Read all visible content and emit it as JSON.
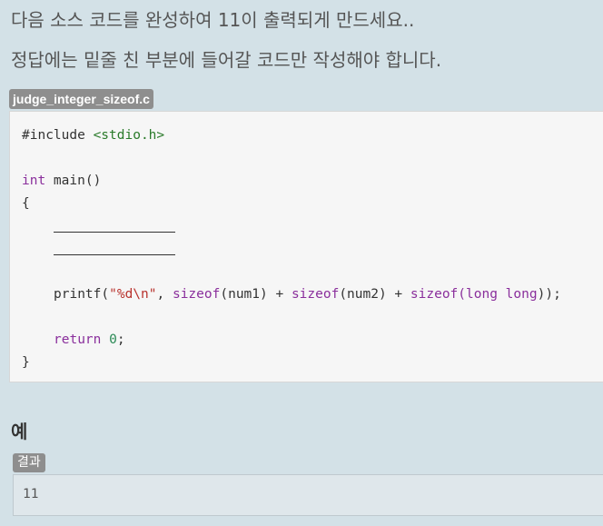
{
  "instructions": {
    "line1": "다음 소스 코드를 완성하여 11이 출력되게 만드세요..",
    "line2": "정답에는 밑줄 친 부분에 들어갈 코드만 작성해야 합니다."
  },
  "code_block": {
    "filename": "judge_integer_sizeof.c",
    "lines": {
      "include_directive": "#include",
      "include_header": "<stdio.h>",
      "int_keyword": "int",
      "main_sig": " main()",
      "open_brace": "{",
      "printf_name": "printf(",
      "format_string": "\"%d\\n\"",
      "comma_space": ", ",
      "sizeof_kw_1": "sizeof",
      "arg_num1": "(num1) + ",
      "sizeof_kw_2": "sizeof",
      "arg_num2": "(num2) + ",
      "sizeof_kw_3": "sizeof",
      "paren_open": "(",
      "long_long": "long long",
      "paren_close": "));",
      "return_kw": "return",
      "return_value": "0",
      "semicolon": ";",
      "close_brace": "}"
    }
  },
  "example": {
    "title": "예",
    "result_label": "결과",
    "result_value": "11"
  }
}
